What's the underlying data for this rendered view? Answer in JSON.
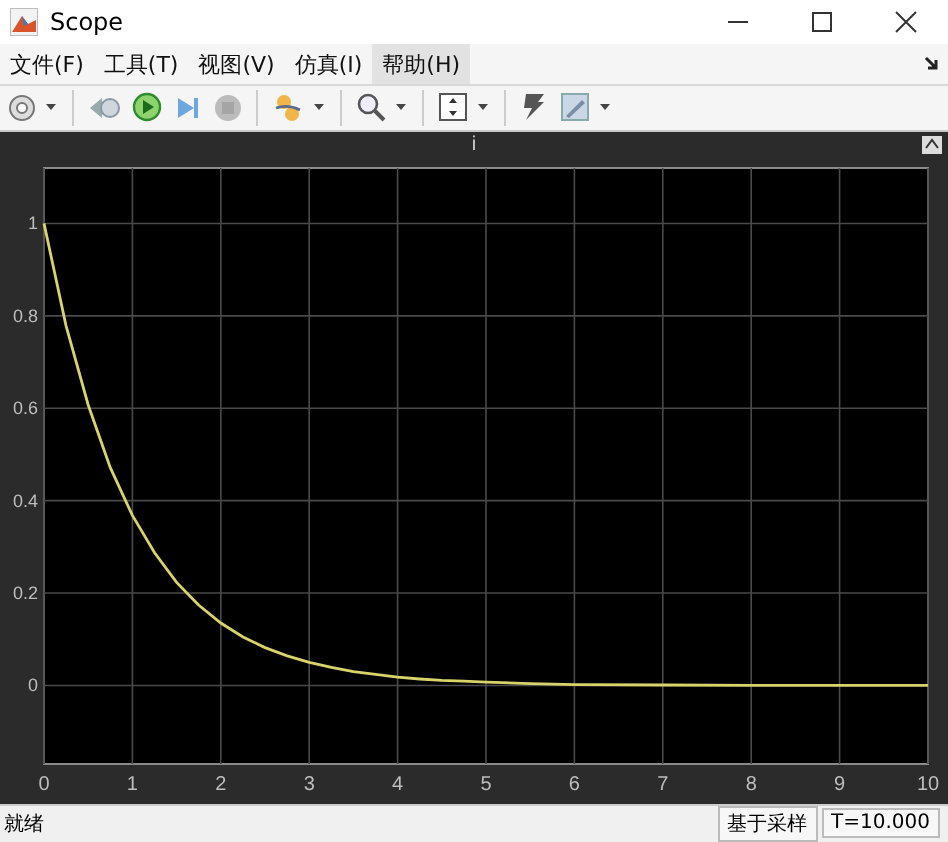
{
  "window": {
    "title": "Scope"
  },
  "menu": [
    {
      "label": "文件(F)",
      "selected": false
    },
    {
      "label": "工具(T)",
      "selected": false
    },
    {
      "label": "视图(V)",
      "selected": false
    },
    {
      "label": "仿真(I)",
      "selected": false
    },
    {
      "label": "帮助(H)",
      "selected": true
    }
  ],
  "plot": {
    "title": "i",
    "chart_data": {
      "type": "line",
      "x": [
        0,
        0.25,
        0.5,
        0.75,
        1,
        1.25,
        1.5,
        1.75,
        2,
        2.25,
        2.5,
        2.75,
        3,
        3.25,
        3.5,
        3.75,
        4,
        4.25,
        4.5,
        4.75,
        5,
        5.5,
        6,
        7,
        8,
        9,
        10
      ],
      "series": [
        {
          "color": "#d8d46a",
          "values": [
            1,
            0.779,
            0.607,
            0.472,
            0.368,
            0.287,
            0.223,
            0.174,
            0.135,
            0.105,
            0.082,
            0.064,
            0.05,
            0.039,
            0.03,
            0.024,
            0.018,
            0.014,
            0.011,
            0.009,
            0.007,
            0.004,
            0.002,
            0.001,
            0,
            0,
            0
          ]
        }
      ],
      "xlim": [
        0,
        10
      ],
      "ylim": [
        -0.17,
        1.12
      ],
      "xticks": [
        0,
        1,
        2,
        3,
        4,
        5,
        6,
        7,
        8,
        9,
        10
      ],
      "yticks": [
        0,
        0.2,
        0.4,
        0.6,
        0.8,
        1
      ],
      "grid": true
    }
  },
  "status_bar": {
    "status": "就绪",
    "sections": [
      "基于采样",
      "T=10.000"
    ]
  }
}
